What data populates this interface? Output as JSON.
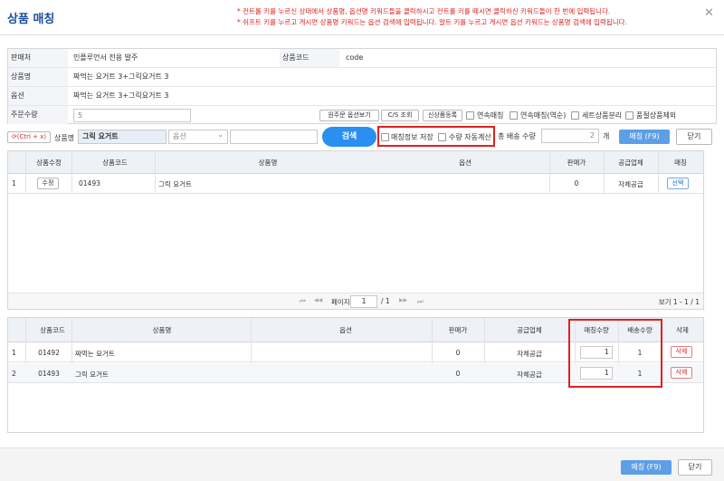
{
  "window": {
    "title": "상품 매칭",
    "close_glyph": "✕"
  },
  "notices": [
    "* 컨트롤 키를 누르신 상태에서 상품명, 옵션명 키워드들을 클릭하시고 컨트롤 키를 떼시면 클릭하신 키워드들이 한 번에 입력됩니다.",
    "* 쉬프트 키를 누르고 게시면 상품명 키워드는 옵션 검색에 입력됩니다. 알트 키를 누르고 게시면 옵션 키워드는 상품명 검색에 입력됩니다."
  ],
  "info": {
    "seller_label": "판매처",
    "seller_value": "인플루언서 전용 발주",
    "code_label": "상품코드",
    "code_value": "code",
    "product_label": "상품명",
    "product_value": "짜먹는 요거트 3+그릭요거트 3",
    "option_label": "옵션",
    "option_value": "짜먹는 요거트 3+그릭요거트 3",
    "qty_label": "주문수량",
    "qty_value": "5",
    "view_origin_option": "원주문 옵션보기",
    "cs_lookup": "C/S 조회",
    "new_product": "신상품등록",
    "chk_link_match": "연속매칭",
    "chk_link_match_rev": "연속매칭(역순)",
    "chk_set_split": "세트상품분리",
    "chk_soldout_exclude": "품절상품제외"
  },
  "search": {
    "refresh_label": "(Ctrl + x)",
    "product_label": "상품명",
    "product_value": "그릭 요거트",
    "option_placeholder": "옵션",
    "option_arrow": "⌄",
    "search_button": "검색",
    "save_match_info": "매칭정보 저장",
    "auto_qty": "수량 자동계산",
    "ship_qty_label": "총 배송 수량",
    "ship_qty_value": "2",
    "unit": "개",
    "match_button": "매칭 (F9)",
    "close_button": "닫기"
  },
  "top_grid": {
    "headers": [
      "상품수정",
      "상품코드",
      "상품명",
      "옵션",
      "판매가",
      "공급업체",
      "매칭"
    ],
    "rows": [
      {
        "no": "1",
        "edit": "수정",
        "code": "01493",
        "name": "그릭 요거트",
        "option": "",
        "price": "0",
        "supplier": "자체공급",
        "select": "선택"
      }
    ],
    "pager": {
      "first": "⏮",
      "prev": "◀◀",
      "page_label": "페이지",
      "page": "1",
      "of": "/ 1",
      "next": "▶▶",
      "last": "⏭",
      "summary": "보기 1 - 1 / 1"
    }
  },
  "bottom_grid": {
    "headers": [
      "상품코드",
      "상품명",
      "옵션",
      "판매가",
      "공급업체",
      "매칭수량",
      "배송수량",
      "삭제"
    ],
    "rows": [
      {
        "no": "1",
        "code": "01492",
        "name": "짜먹는 요거트",
        "option": "",
        "price": "0",
        "supplier": "자체공급",
        "match_qty": "1",
        "ship_qty": "1",
        "delete": "삭제"
      },
      {
        "no": "2",
        "code": "01493",
        "name": "그릭 요거트",
        "option": "",
        "price": "0",
        "supplier": "자체공급",
        "match_qty": "1",
        "ship_qty": "1",
        "delete": "삭제"
      }
    ]
  },
  "footer": {
    "match_button": "매칭 (F9)",
    "close_button": "닫기"
  },
  "colors": {
    "accent": "#2a8ff0",
    "title": "#1a4f9c",
    "notice": "#e02020",
    "highlight": "#e02020"
  }
}
